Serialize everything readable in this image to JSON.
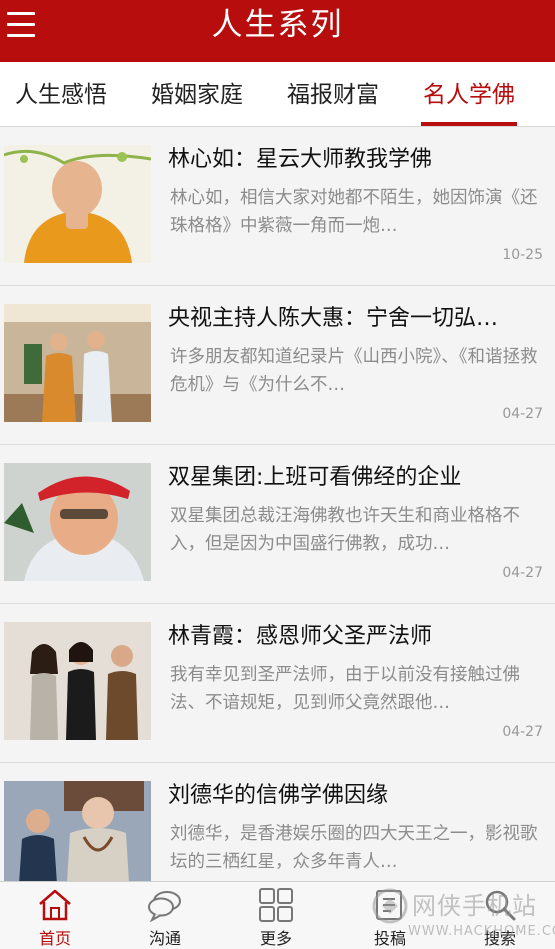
{
  "header": {
    "title": "人生系列"
  },
  "tabs": [
    {
      "label": "人生感悟"
    },
    {
      "label": "婚姻家庭"
    },
    {
      "label": "福报财富"
    },
    {
      "label": "名人学佛",
      "active": true
    }
  ],
  "articles": [
    {
      "title": "林心如：星云大师教我学佛",
      "summary": "林心如，相信大家对她都不陌生，她因饰演《还珠格格》中紫薇一角而一炮…",
      "date": "10-25"
    },
    {
      "title": "央视主持人陈大惠：宁舍一切弘…",
      "summary": "许多朋友都知道纪录片《山西小院》、《和谐拯救危机》与《为什么不…",
      "date": "04-27"
    },
    {
      "title": "双星集团:上班可看佛经的企业",
      "summary": "双星集团总裁汪海佛教也许天生和商业格格不入，但是因为中国盛行佛教，成功…",
      "date": "04-27"
    },
    {
      "title": "林青霞：感恩师父圣严法师",
      "summary": "我有幸见到圣严法师，由于以前没有接触过佛法、不谙规矩，见到师父竟然跟他…",
      "date": "04-27"
    },
    {
      "title": "刘德华的信佛学佛因缘",
      "summary": "刘德华，是香港娱乐圈的四大天王之一，影视歌坛的三栖红星，众多年青人…",
      "date": ""
    }
  ],
  "bottom_nav": [
    {
      "label": "首页",
      "icon": "home-icon",
      "active": true
    },
    {
      "label": "沟通",
      "icon": "chat-icon"
    },
    {
      "label": "更多",
      "icon": "grid-icon"
    },
    {
      "label": "投稿",
      "icon": "submit-icon"
    },
    {
      "label": "搜索",
      "icon": "search-icon"
    }
  ],
  "watermark": {
    "text": "网侠手机站",
    "url": "WWW.HACKHOME.COM"
  },
  "colors": {
    "brand": "#b70d0d",
    "background": "#ebebeb",
    "card": "#f4f4f4",
    "muted": "#8c8c8c"
  }
}
